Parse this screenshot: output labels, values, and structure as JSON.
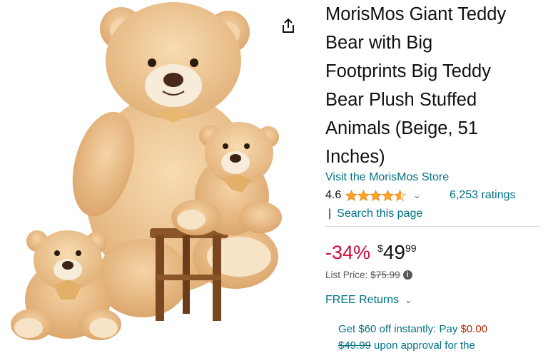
{
  "product": {
    "title": "MorisMos Giant Teddy Bear with Big Footprints Big Teddy Bear Plush Stuffed Animals (Beige, 51 Inches)",
    "title_lines": [
      "MorisMos Giant Teddy",
      "Bear with Big",
      "Footprints Big Teddy",
      "Bear Plush Stuffed",
      "Animals (Beige, 51",
      "Inches)"
    ],
    "store_link": "Visit the MorisMos Store",
    "rating_value": "4.6",
    "rating_stars": 4.6,
    "ratings_count": "6,253 ratings",
    "search_link": "Search this page"
  },
  "pricing": {
    "discount": "-34%",
    "currency": "$",
    "whole": "49",
    "fraction": "99",
    "list_price_label": "List Price:",
    "list_price": "$75.99"
  },
  "returns": {
    "label": "FREE Returns"
  },
  "promo": {
    "line1_prefix": "Get $60 off instantly: Pay ",
    "line1_amount": "$0.00",
    "line2_strike": "$49.99",
    "line2_suffix": " upon approval for the"
  },
  "colors": {
    "link": "#007185",
    "discount": "#cc0c39",
    "star": "#ffa41c",
    "bear_fur": "#f0c996"
  },
  "icons": {
    "share": "share-icon",
    "chevron": "chevron-down-icon",
    "info": "info-icon"
  }
}
